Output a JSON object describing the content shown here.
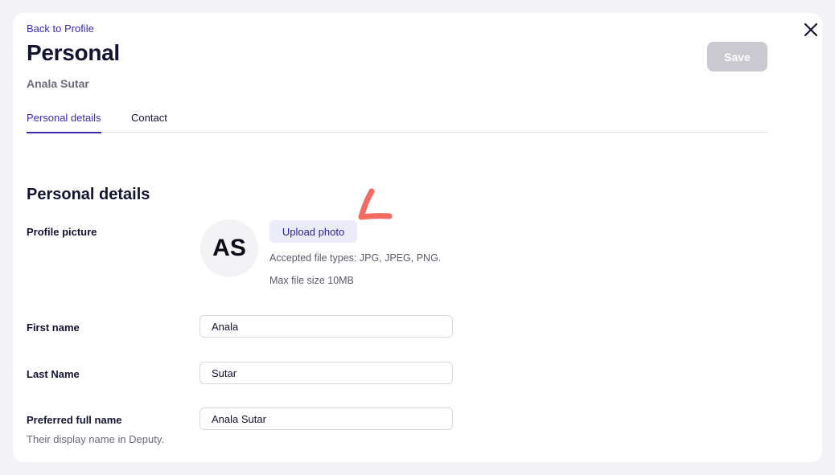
{
  "header": {
    "back_link": "Back to Profile",
    "title": "Personal",
    "subtitle": "Anala Sutar",
    "save_label": "Save"
  },
  "tabs": [
    {
      "label": "Personal details",
      "active": true
    },
    {
      "label": "Contact",
      "active": false
    }
  ],
  "section": {
    "title": "Personal details",
    "profile_picture": {
      "label": "Profile picture",
      "initials": "AS",
      "upload_label": "Upload photo",
      "accepted_types": "Accepted file types: JPG, JPEG, PNG.",
      "max_size": "Max file size 10MB"
    },
    "first_name": {
      "label": "First name",
      "value": "Anala"
    },
    "last_name": {
      "label": "Last Name",
      "value": "Sutar"
    },
    "preferred_name": {
      "label": "Preferred full name",
      "value": "Anala Sutar",
      "helper": "Their display name in Deputy."
    }
  },
  "icons": {
    "close": "close-icon",
    "annotation": "annotation-mark"
  },
  "colors": {
    "accent": "#3b2bb0",
    "annotation": "#f26b63",
    "save_disabled": "#c9c9cf",
    "upload_bg": "#ecebfa"
  }
}
